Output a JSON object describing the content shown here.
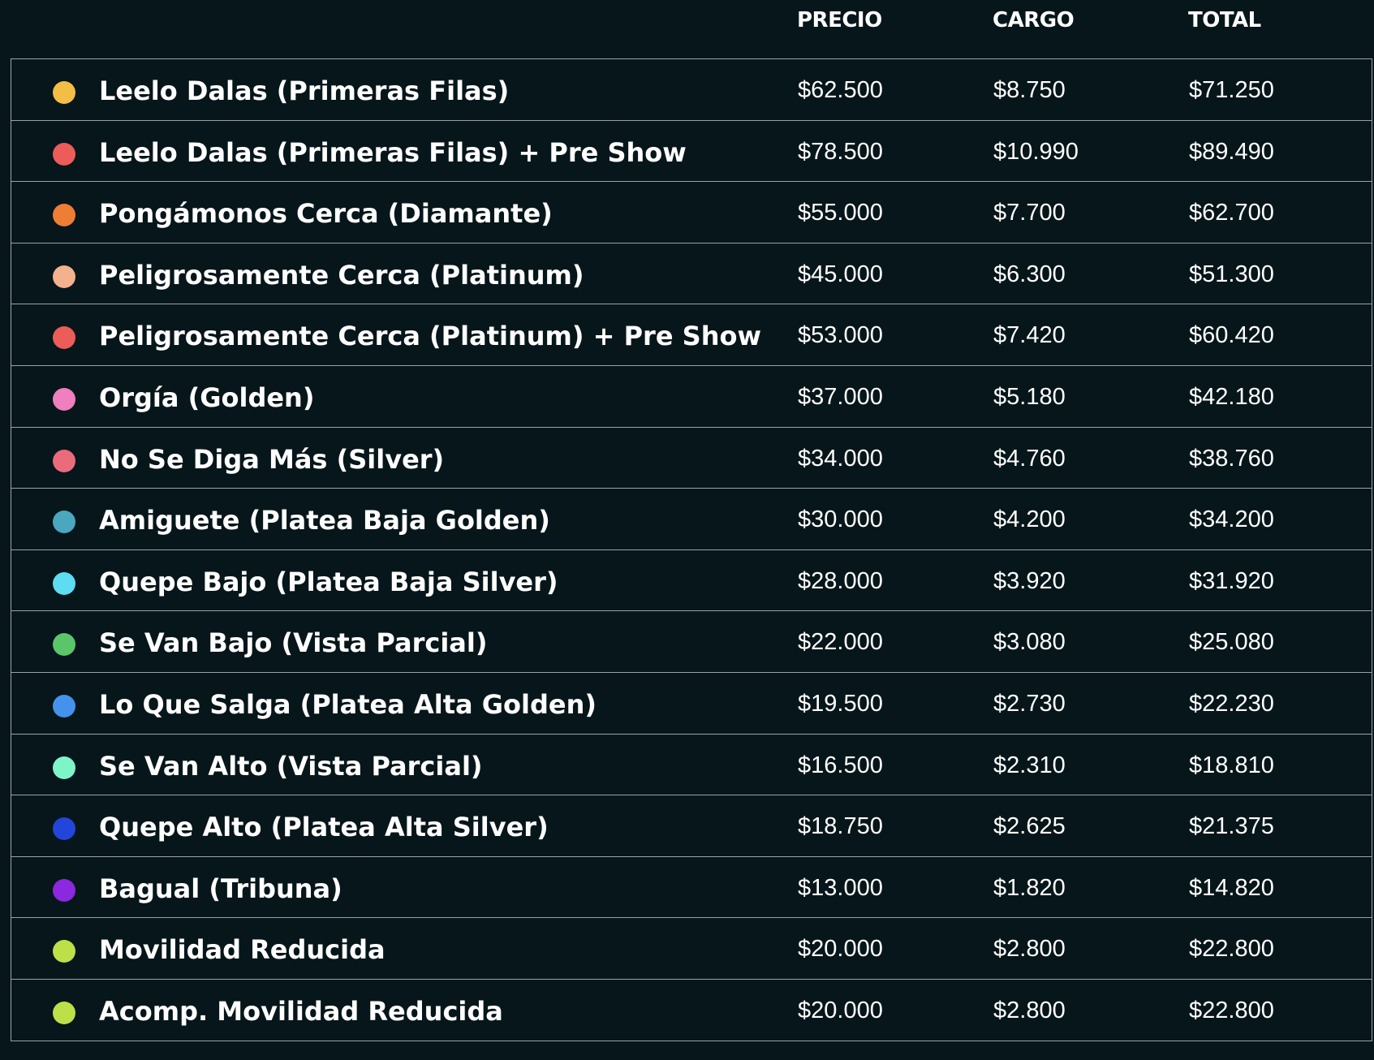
{
  "headers": {
    "precio": "PRECIO",
    "cargo": "CARGO",
    "total": "TOTAL"
  },
  "rows": [
    {
      "name": "Leelo Dalas (Primeras Filas)",
      "color": "#f4bd45",
      "precio": "$62.500",
      "cargo": "$8.750",
      "total": "$71.250"
    },
    {
      "name": "Leelo Dalas (Primeras Filas) + Pre Show",
      "color": "#ec5c58",
      "precio": "$78.500",
      "cargo": "$10.990",
      "total": "$89.490"
    },
    {
      "name": "Pongámonos Cerca (Diamante)",
      "color": "#ee7d35",
      "precio": "$55.000",
      "cargo": "$7.700",
      "total": "$62.700"
    },
    {
      "name": "Peligrosamente Cerca (Platinum)",
      "color": "#f3b18e",
      "precio": "$45.000",
      "cargo": "$6.300",
      "total": "$51.300"
    },
    {
      "name": "Peligrosamente Cerca (Platinum) + Pre Show",
      "color": "#ec5c58",
      "precio": "$53.000",
      "cargo": "$7.420",
      "total": "$60.420"
    },
    {
      "name": "Orgía (Golden)",
      "color": "#ef7fbe",
      "precio": "$37.000",
      "cargo": "$5.180",
      "total": "$42.180"
    },
    {
      "name": "No Se Diga Más (Silver)",
      "color": "#ea6b7c",
      "precio": "$34.000",
      "cargo": "$4.760",
      "total": "$38.760"
    },
    {
      "name": "Amiguete (Platea Baja Golden)",
      "color": "#4ba6bf",
      "precio": "$30.000",
      "cargo": "$4.200",
      "total": "$34.200"
    },
    {
      "name": "Quepe Bajo (Platea Baja Silver)",
      "color": "#5ddcf2",
      "precio": "$28.000",
      "cargo": "$3.920",
      "total": "$31.920"
    },
    {
      "name": "Se Van Bajo (Vista Parcial)",
      "color": "#5bc56a",
      "precio": "$22.000",
      "cargo": "$3.080",
      "total": "$25.080"
    },
    {
      "name": "Lo Que Salga (Platea Alta Golden)",
      "color": "#4592ec",
      "precio": "$19.500",
      "cargo": "$2.730",
      "total": "$22.230"
    },
    {
      "name": "Se Van Alto (Vista Parcial)",
      "color": "#7ef5c9",
      "precio": "$16.500",
      "cargo": "$2.310",
      "total": "$18.810"
    },
    {
      "name": "Quepe Alto (Platea Alta Silver)",
      "color": "#2346da",
      "precio": "$18.750",
      "cargo": "$2.625",
      "total": "$21.375"
    },
    {
      "name": "Bagual (Tribuna)",
      "color": "#8c28df",
      "precio": "$13.000",
      "cargo": "$1.820",
      "total": "$14.820"
    },
    {
      "name": "Movilidad Reducida",
      "color": "#bde049",
      "precio": "$20.000",
      "cargo": "$2.800",
      "total": "$22.800"
    },
    {
      "name": "Acomp. Movilidad Reducida",
      "color": "#bde049",
      "precio": "$20.000",
      "cargo": "$2.800",
      "total": "$22.800"
    }
  ]
}
